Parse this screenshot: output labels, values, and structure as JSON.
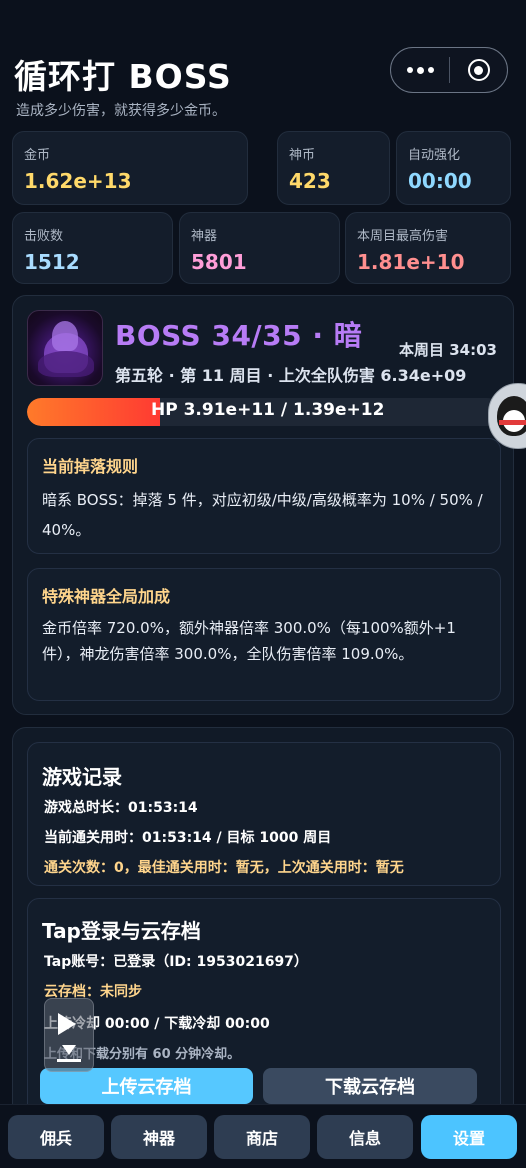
{
  "header": {
    "title": "循环打 BOSS",
    "subtitle": "造成多少伤害，就获得多少金币。"
  },
  "capsule": {
    "more_icon": "more-dots-icon",
    "close_icon": "target-circle-icon"
  },
  "stats": {
    "gold": {
      "label": "金币",
      "value": "1.62e+13",
      "color": "#ffd96a"
    },
    "coin": {
      "label": "神币",
      "value": "423",
      "color": "#ffd96a"
    },
    "auto": {
      "label": "自动强化",
      "value": "00:00",
      "color": "#8fd8ff"
    },
    "kills": {
      "label": "击败数",
      "value": "1512",
      "color": "#a9dcff"
    },
    "artifacts": {
      "label": "神器",
      "value": "5801",
      "color": "#ff9ed8"
    },
    "maxdmg": {
      "label": "本周目最高伤害",
      "value": "1.81e+10",
      "color": "#ff8f8f"
    }
  },
  "boss": {
    "title": "BOSS 34/35 · 暗",
    "cycle": "本周目 34:03",
    "meta": "第五轮 · 第 11 周目 · 上次全队伤害 6.34e+09",
    "hp_text": "HP 3.91e+11 / 1.39e+12",
    "hp_fraction": 0.281,
    "drop_title": "当前掉落规则",
    "drop_text": "暗系 BOSS：掉落 5 件，对应初级/中级/高级概率为 10% / 50% / 40%。",
    "bonus_title": "特殊神器全局加成",
    "bonus_text": "金币倍率 720.0%，额外神器倍率 300.0%（每100%额外+1件），神龙伤害倍率 300.0%，全队伤害倍率 109.0%。"
  },
  "record": {
    "title": "游戏记录",
    "total_time": "游戏总时长：01:53:14",
    "current_time": "当前通关用时：01:53:14 / 目标 1000 周目",
    "clears": "通关次数：0，最佳通关用时：暂无，上次通关用时：暂无"
  },
  "cloud": {
    "title": "Tap登录与云存档",
    "account": "Tap账号：已登录（ID: 1953021697）",
    "status": "云存档：未同步",
    "cooldown": "上传冷却 00:00 / 下载冷却 00:00",
    "note": "上传和下载分别有 60 分钟冷却。",
    "upload_label": "上传云存档",
    "download_label": "下载云存档"
  },
  "nav": {
    "items": [
      "佣兵",
      "神器",
      "商店",
      "信息",
      "设置"
    ],
    "active": "设置"
  }
}
